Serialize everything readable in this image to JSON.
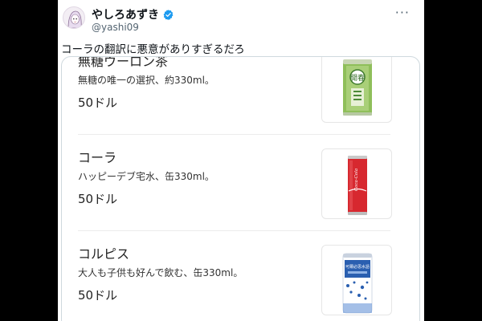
{
  "author": {
    "display_name": "やしろあずき",
    "handle": "@yashi09"
  },
  "tweet": {
    "text": "コーラの翻訳に悪意がありすぎるだろ",
    "more_label": "···"
  },
  "menu_items": [
    {
      "title": "無糖ウーロン茶",
      "desc": "無糖の唯一の選択、約330ml。",
      "price": "50ドル",
      "can_label": "開春"
    },
    {
      "title": "コーラ",
      "desc": "ハッピーデブ宅水、缶330ml。",
      "price": "50ドル",
      "can_label": "Coca-Cola"
    },
    {
      "title": "コルピス",
      "desc": "大人も子供も好んで飲む、缶330ml。",
      "price": "50ドル",
      "can_label": "可爾必思水語"
    }
  ],
  "colors": {
    "verified": "#1d9bf0",
    "text_primary": "#0f1419",
    "text_secondary": "#536471",
    "oolong_can": "#8fbf5a",
    "cola_can": "#d7282f",
    "calpis_can": "#2a5fb0"
  },
  "icons": [
    "verified-badge-icon",
    "more-icon"
  ]
}
